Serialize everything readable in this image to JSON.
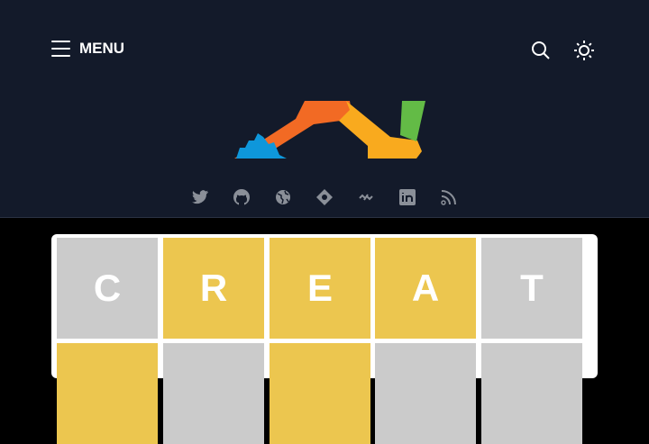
{
  "header": {
    "menu_label": "MENU"
  },
  "social": [
    "twitter-icon",
    "github-icon",
    "globe-icon",
    "diamond-icon",
    "link-icon",
    "linkedin-icon",
    "rss-icon"
  ],
  "colors": {
    "header_bg": "#131a2a",
    "gray_tile": "#cbcbcb",
    "yellow_tile": "#ecc64f"
  },
  "grid": {
    "rows": [
      [
        {
          "letter": "C",
          "state": "gray"
        },
        {
          "letter": "R",
          "state": "yellow"
        },
        {
          "letter": "E",
          "state": "yellow"
        },
        {
          "letter": "A",
          "state": "yellow"
        },
        {
          "letter": "T",
          "state": "gray"
        }
      ],
      [
        {
          "letter": "",
          "state": "yellow"
        },
        {
          "letter": "",
          "state": "gray"
        },
        {
          "letter": "",
          "state": "yellow"
        },
        {
          "letter": "",
          "state": "gray"
        },
        {
          "letter": "",
          "state": "gray"
        }
      ]
    ]
  }
}
